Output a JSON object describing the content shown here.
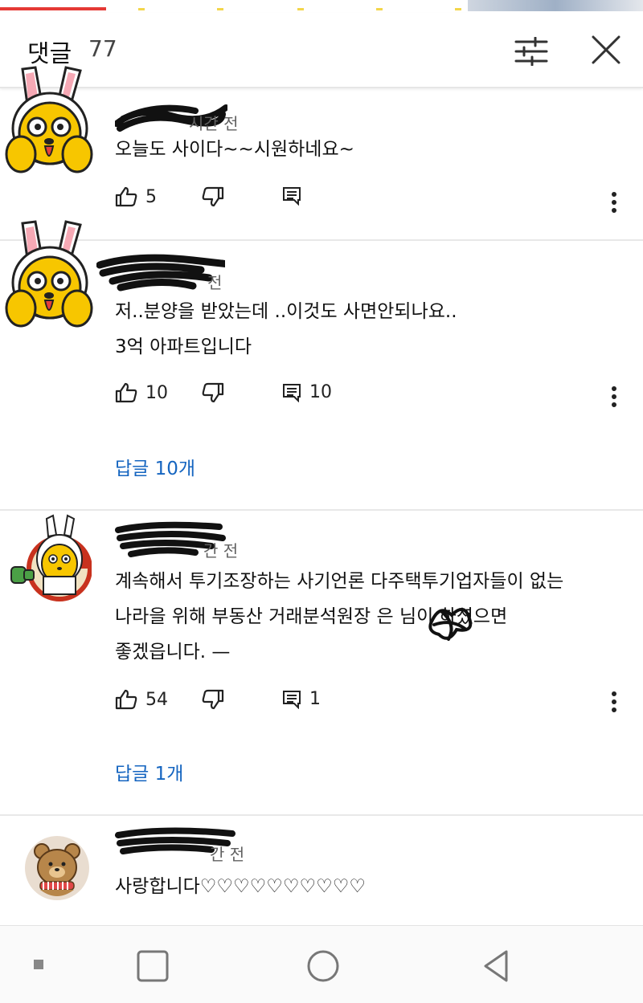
{
  "header": {
    "title": "댓글",
    "count": "77"
  },
  "comments": [
    {
      "meta": "시간 전",
      "text": "오늘도 사이다~~시원하네요~",
      "likes": "5",
      "reply_count": ""
    },
    {
      "meta": "전",
      "text": "저..분양을 받았는데 ..이것도   사면안되나요..\n3억 아파트입니다",
      "likes": "10",
      "reply_count": "10",
      "replies_link": "답글 10개"
    },
    {
      "meta": "간 전",
      "text": "계속해서 투기조장하는 사기언론 다주택투기업자들이 없는\n나라을 위해 부동산 거래분석원장 은      님이 하셨으면\n좋겠읍니다. —",
      "likes": "54",
      "reply_count": "1",
      "replies_link": "답글 1개"
    },
    {
      "meta": "간 전",
      "text": "사랑합니다♡♡♡♡♡♡♡♡♡♡"
    }
  ],
  "icons": {
    "filter": "sliders-icon",
    "close": "close-icon",
    "like": "thumb-up-icon",
    "dislike": "thumb-down-icon",
    "reply": "comment-icon",
    "more": "more-vertical-icon",
    "nav_recent": "square-small-icon",
    "nav_home": "circle-icon",
    "nav_back": "triangle-back-icon",
    "nav_overview": "square-icon"
  },
  "colors": {
    "accent": "#e53935",
    "link": "#1565c0"
  }
}
